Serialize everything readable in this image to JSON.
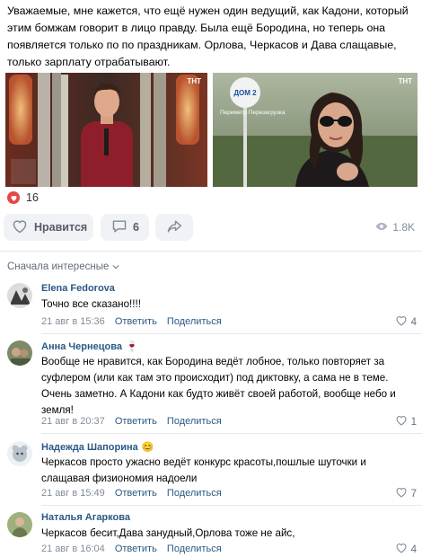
{
  "post": {
    "text": "Уважаемые, мне кажется, что ещё нужен один ведущий, как Кадони, который этим бомжам говорит в лицо правду. Была ещё Бородина, но теперь она появляется только по по праздникам. Орлова, Черкасов и Дава слащавые, только зарплату отрабатывают.",
    "photo1_badge": "ТНТ",
    "photo2_sign": "Периметр Перезагрузка",
    "photo2_logo": "ДОМ 2",
    "photo2_badge": "ТНТ",
    "reactions_count": "16",
    "like_label": "Нравится",
    "comments_count": "6",
    "views": "1.8K"
  },
  "sort_label": "Сначала интересные",
  "comments": [
    {
      "name": "Elena Fedorova",
      "text": "Точно все сказано!!!!",
      "date": "21 авг в 15:36",
      "reply": "Ответить",
      "share": "Поделиться",
      "likes": "4"
    },
    {
      "name": "Анна Чернецова",
      "emoji": "🍷",
      "text": "Вообще не нравится, как Бородина ведёт лобное, только повторяет за суфлером (или как там это происходит) под диктовку, а сама не в теме. Очень заметно. А Кадони как будто живёт своей работой, вообще небо и земля!",
      "date": "21 авг в 20:37",
      "reply": "Ответить",
      "share": "Поделиться",
      "likes": "1"
    },
    {
      "name": "Надежда Шапорина",
      "emoji": "😊",
      "text": "Черкасов просто ужасно ведёт конкурс красоты,пошлые шуточки и слащавая физиономия надоели",
      "date": "21 авг в 15:49",
      "reply": "Ответить",
      "share": "Поделиться",
      "likes": "7"
    },
    {
      "name": "Наталья Агаркова",
      "text": "Черкасов бесит,Дава занудный,Орлова тоже не айс,",
      "date": "21 авг в 16:04",
      "reply": "Ответить",
      "share": "Поделиться",
      "likes": "4"
    }
  ],
  "icons": {
    "reaction": "heart-icon",
    "like": "heart-outline-icon",
    "comment": "speech-bubble-icon",
    "share": "share-arrow-icon",
    "views": "eye-icon",
    "sort": "chevron-down-icon",
    "comment_like": "heart-outline-icon"
  },
  "colors": {
    "link": "#2a5885",
    "muted": "#818c99",
    "reaction": "#e64646",
    "button_bg": "#f0f2f5"
  }
}
